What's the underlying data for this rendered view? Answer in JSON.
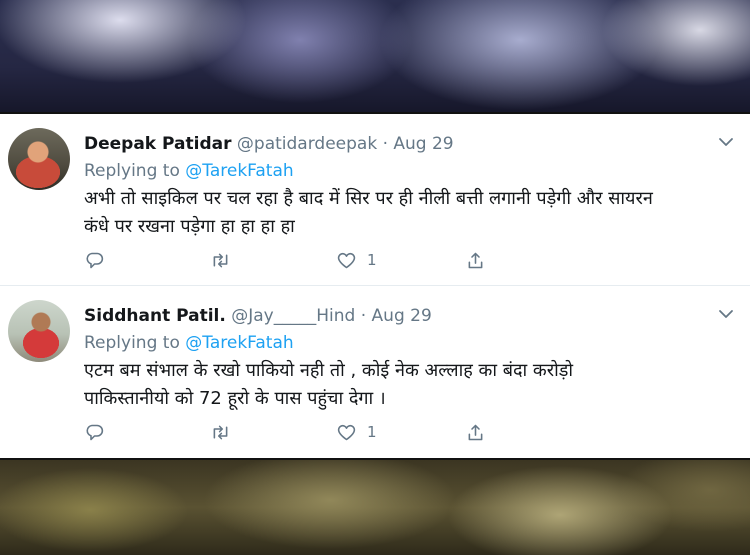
{
  "tweets": [
    {
      "name": "Deepak Patidar",
      "handle": "@patidardeepak",
      "separator": "·",
      "date": "Aug 29",
      "replying_prefix": "Replying to",
      "replying_to": "@TarekFatah",
      "text_line1": "अभी तो साइकिल पर चल रहा है बाद में सिर पर ही  नीली बत्ती लगानी पड़ेगी और सायरन",
      "text_line2": "कंधे पर  रखना पड़ेगा हा हा हा हा",
      "like_count": "1"
    },
    {
      "name": "Siddhant Patil.",
      "handle": "@Jay_____Hind",
      "separator": "·",
      "date": "Aug 29",
      "replying_prefix": "Replying to",
      "replying_to": "@TarekFatah",
      "text_line1": "एटम बम संभाल के रखो पाकियो नही तो , कोई नेक अल्लाह का बंदा करोड़ो",
      "text_line2": "पाकिस्तानीयो को 72 हूरो के पास पहुंचा देगा ।",
      "like_count": "1"
    }
  ],
  "icons": {
    "reply": "reply-icon",
    "retweet": "retweet-icon",
    "like": "heart-icon",
    "share": "share-icon",
    "menu": "chevron-down-icon"
  },
  "colors": {
    "link": "#1da1f2",
    "secondary_text": "#657786",
    "primary_text": "#14171a"
  }
}
